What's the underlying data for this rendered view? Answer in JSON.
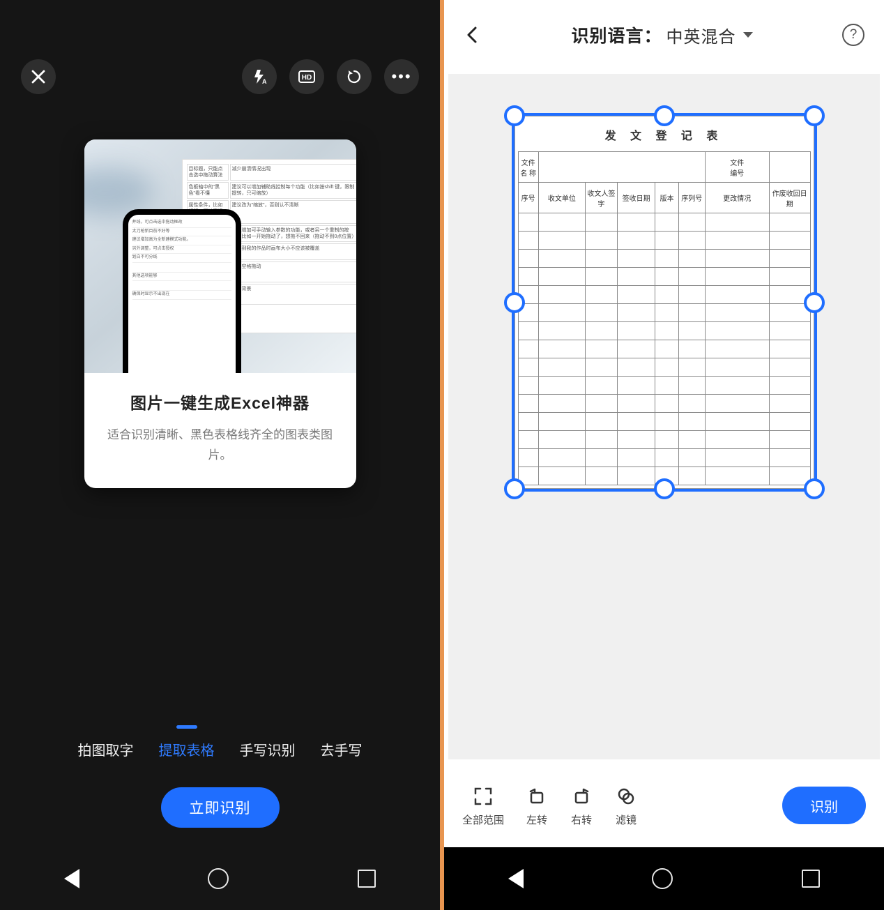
{
  "left": {
    "card": {
      "title": "图片一键生成Excel神器",
      "subtitle": "适合识别清晰、黑色表格线齐全的图表类图片。"
    },
    "tabs": [
      "拍图取字",
      "提取表格",
      "手写识别",
      "去手写"
    ],
    "active_tab_index": 1,
    "primary_button": "立即识别",
    "top_icons": {
      "close": "close-icon",
      "flash": "flash-auto-icon",
      "hd": "HD",
      "refresh": "refresh-icon",
      "more": "…"
    },
    "preview_snippets": [
      "减少崩溃情况出现",
      "建议可以增加辅助线控制每个功能（比如按shift 键，限制提转，只可缩放）",
      "建议改为\"缩放\"，否则认不清晰",
      "建议增加可手动输入参数的功能，或者另一个重制的按钮，比如一开始拖动了，想拖不回来（拖动不到0点位置）",
      "保存到我的作品时画布大小不应该被覆盖",
      "增加空格拖动"
    ]
  },
  "right": {
    "header": {
      "label": "识别语言：",
      "language": "中英混合"
    },
    "document": {
      "title": "发 文 登 记 表",
      "row1_left": "文件\n名 称",
      "row1_right": "文件\n编号",
      "columns": [
        "序号",
        "收文单位",
        "收文人签字",
        "签收日期",
        "版本",
        "序列号",
        "更改情况",
        "作废收回日  期"
      ]
    },
    "tools": [
      "全部范围",
      "左转",
      "右转",
      "滤镜"
    ],
    "recognize": "识别"
  }
}
